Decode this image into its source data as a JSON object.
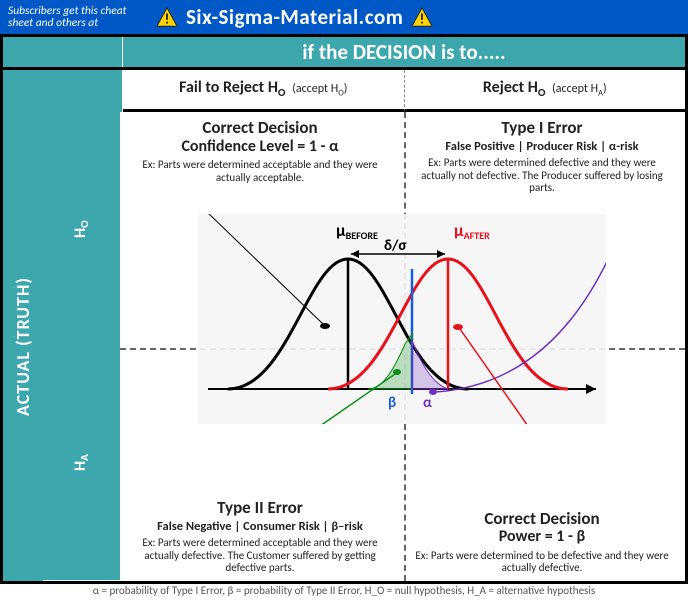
{
  "topbar": {
    "subscribe": "Subscribers get this cheat sheet and others at",
    "site": "Six-Sigma-Material.com"
  },
  "header": {
    "decision": "if the DECISION is to.....",
    "fail_label": "Fail to Reject H",
    "fail_sub": "O",
    "fail_accept": " (accept H",
    "fail_accept_sub": "O",
    "fail_accept_end": ")",
    "reject_label": "Reject H",
    "reject_sub": "O",
    "reject_accept": " (accept H",
    "reject_accept_sub": "A",
    "reject_accept_end": ")"
  },
  "spine": {
    "actual": "ACTUAL (TRUTH)",
    "ho_label": "H",
    "ho_sub": "O",
    "ha_label": "H",
    "ha_sub": "A"
  },
  "quads": {
    "tl": {
      "title1": "Correct Decision",
      "title2": "Confidence Level = 1 - α",
      "ex": "Ex: Parts were determined acceptable and they were actually acceptable."
    },
    "tr": {
      "title1": "Type I Error",
      "subline": "False Positive | Producer Risk | α-risk",
      "ex": "Ex: Parts were determined defective and they were actually not defective. The Producer suffered by losing parts."
    },
    "bl": {
      "title1": "Type II Error",
      "subline": "False Negative | Consumer Risk | β–risk",
      "ex": "Ex: Parts were determined acceptable and they were actually defective. The Customer suffered by getting defective parts."
    },
    "br": {
      "title1": "Correct Decision",
      "title2": "Power = 1 - β",
      "ex": "Ex: Parts were determined to be defective and they were actually defective."
    }
  },
  "figure": {
    "mu_before": "μ",
    "mu_before_sub": "BEFORE",
    "mu_after": "μ",
    "mu_after_sub": "AFTER",
    "delta": "δ/σ",
    "alpha": "α",
    "beta": "β"
  },
  "legend": "α = probability of Type I Error,  β = probability of Type II Error, H_O = null hypothesis, H_A = alternative hypothesis",
  "chart_data": {
    "type": "diagram",
    "title": "Hypothesis test decision matrix with two overlapping normal distributions",
    "curves": [
      {
        "name": "BEFORE (H0)",
        "color": "#000000",
        "mu_position": 0.42
      },
      {
        "name": "AFTER (HA)",
        "color": "#E8111A",
        "mu_position": 0.62
      }
    ],
    "critical_line_position": 0.54,
    "regions": {
      "alpha": "area of H0 curve right of critical line",
      "beta": "area of HA curve left of critical line",
      "confidence": "area of H0 curve left of critical line = 1 - α",
      "power": "area of HA curve right of critical line = 1 - β"
    },
    "rows": [
      "H_O true",
      "H_A true"
    ],
    "cols": [
      "Fail to Reject H_O (accept H_O)",
      "Reject H_O (accept H_A)"
    ],
    "cells": [
      [
        "Correct Decision, Confidence Level = 1 - α",
        "Type I Error, False Positive, Producer Risk, α-risk"
      ],
      [
        "Type II Error, False Negative, Consumer Risk, β-risk",
        "Correct Decision, Power = 1 - β"
      ]
    ]
  }
}
